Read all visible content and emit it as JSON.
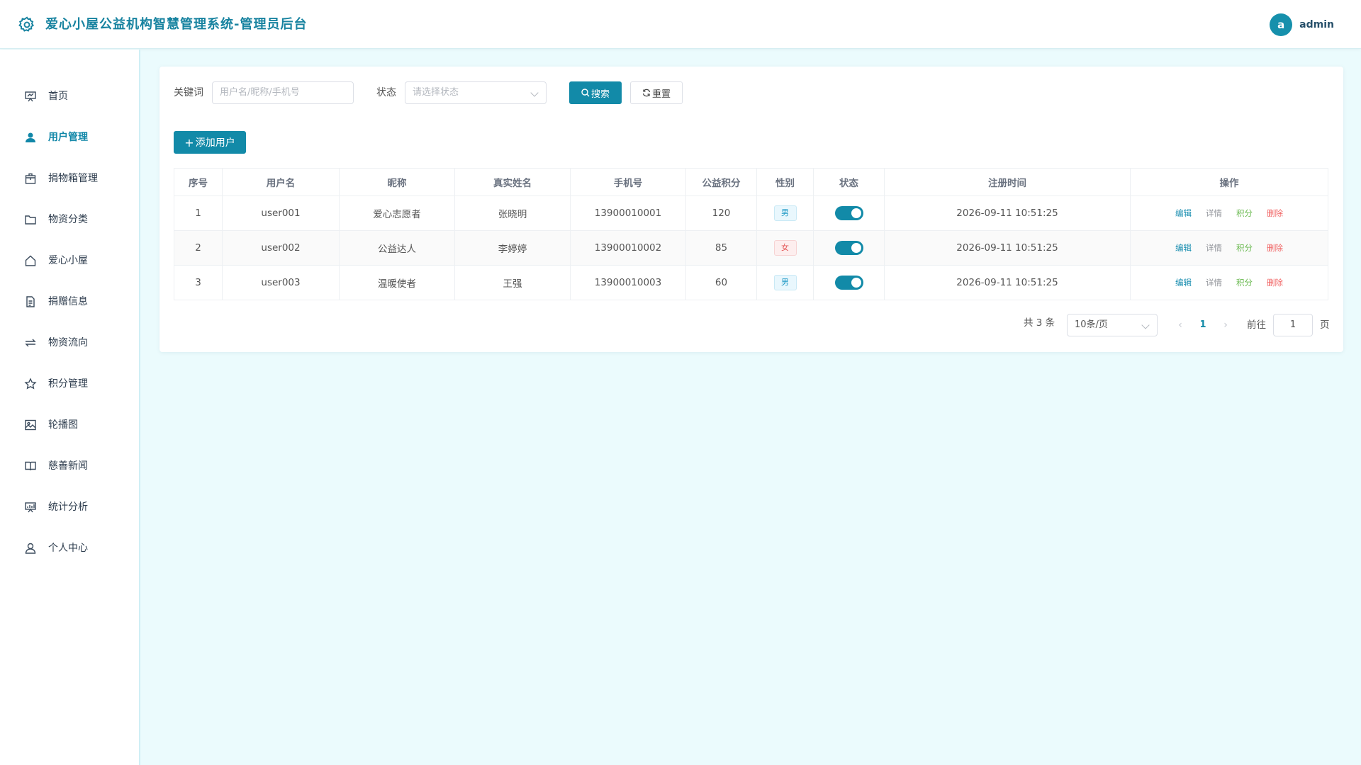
{
  "header": {
    "title": "爱心小屋公益机构智慧管理系统-管理员后台",
    "avatar_letter": "a",
    "username": "admin"
  },
  "sidebar": {
    "items": [
      {
        "label": "首页",
        "icon": "dashboard-icon"
      },
      {
        "label": "用户管理",
        "icon": "user-icon"
      },
      {
        "label": "捐物箱管理",
        "icon": "box-icon"
      },
      {
        "label": "物资分类",
        "icon": "folder-icon"
      },
      {
        "label": "爱心小屋",
        "icon": "house-icon"
      },
      {
        "label": "捐赠信息",
        "icon": "document-icon"
      },
      {
        "label": "物资流向",
        "icon": "flow-icon"
      },
      {
        "label": "积分管理",
        "icon": "star-icon"
      },
      {
        "label": "轮播图",
        "icon": "image-icon"
      },
      {
        "label": "慈善新闻",
        "icon": "book-icon"
      },
      {
        "label": "统计分析",
        "icon": "chart-icon"
      },
      {
        "label": "个人中心",
        "icon": "person-icon"
      }
    ],
    "active_index": 1
  },
  "filters": {
    "keyword_label": "关键词",
    "keyword_placeholder": "用户名/昵称/手机号",
    "status_label": "状态",
    "status_placeholder": "请选择状态",
    "search_label": "搜索",
    "reset_label": "重置"
  },
  "add_user_label": "添加用户",
  "table": {
    "columns": [
      "序号",
      "用户名",
      "昵称",
      "真实姓名",
      "手机号",
      "公益积分",
      "性别",
      "状态",
      "注册时间",
      "操作"
    ],
    "rows": [
      {
        "index": "1",
        "username": "user001",
        "nickname": "爱心志愿者",
        "real_name": "张晓明",
        "phone": "13900010001",
        "points": "120",
        "gender": "男",
        "enabled": true,
        "registered": "2026-09-11 10:51:25"
      },
      {
        "index": "2",
        "username": "user002",
        "nickname": "公益达人",
        "real_name": "李婷婷",
        "phone": "13900010002",
        "points": "85",
        "gender": "女",
        "enabled": true,
        "registered": "2026-09-11 10:51:25"
      },
      {
        "index": "3",
        "username": "user003",
        "nickname": "温暖使者",
        "real_name": "王强",
        "phone": "13900010003",
        "points": "60",
        "gender": "男",
        "enabled": true,
        "registered": "2026-09-11 10:51:25"
      }
    ],
    "actions": {
      "edit": "编辑",
      "detail": "详情",
      "points": "积分",
      "delete": "删除"
    }
  },
  "pagination": {
    "total": "共 3 条",
    "page_size": "10条/页",
    "current_page": "1",
    "goto_label": "前往",
    "goto_value": "1",
    "page_suffix": "页"
  },
  "colors": {
    "primary": "#128aa8",
    "background": "#ebfbfd",
    "male_tag": "#1c97c4",
    "female_tag": "#e45a5a",
    "points_action": "#67b84d",
    "delete_action": "#f06363"
  }
}
